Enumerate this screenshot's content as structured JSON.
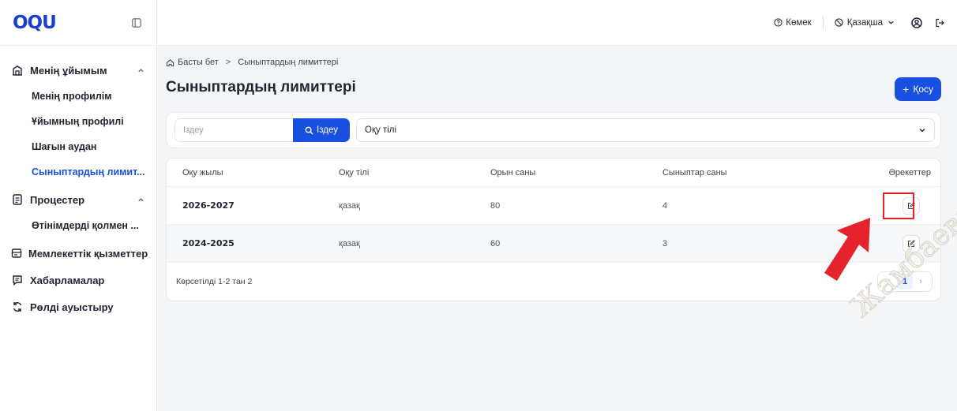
{
  "app": {
    "logo_text": "OQU"
  },
  "header": {
    "help_label": "Көмек",
    "language_label": "Қазақша",
    "user_icon": "user-circle-icon",
    "logout_icon": "logout-icon"
  },
  "sidebar": {
    "groups": [
      {
        "label": "Менің ұйымым",
        "icon": "building-icon",
        "expanded": true,
        "items": [
          {
            "label": "Менің профилім"
          },
          {
            "label": "Ұйымның профилі"
          },
          {
            "label": "Шағын аудан"
          },
          {
            "label": "Сыныптардың лимит...",
            "active": true
          }
        ]
      },
      {
        "label": "Процестер",
        "icon": "document-icon",
        "expanded": true,
        "items": [
          {
            "label": "Өтінімдерді қолмен ..."
          }
        ]
      },
      {
        "label": "Мемлекеттік қызметтер",
        "icon": "services-icon"
      },
      {
        "label": "Хабарламалар",
        "icon": "message-icon"
      },
      {
        "label": "Рөлді ауыстыру",
        "icon": "switch-icon"
      }
    ]
  },
  "main": {
    "breadcrumb": {
      "home": "Басты бет",
      "current": "Сыныптардың лимиттері"
    },
    "title": "Сыныптардың лимиттері",
    "add_button": "Қосу",
    "search": {
      "placeholder": "Іздеу",
      "button": "Іздеу"
    },
    "language_filter": {
      "placeholder": "Оқу тілі"
    },
    "table": {
      "columns": [
        "Оқу жылы",
        "Оқу тілі",
        "Орын саны",
        "Сыныптар саны",
        "Әрекеттер"
      ],
      "rows": [
        {
          "year": "2026-2027",
          "lang": "қазақ",
          "seats": "80",
          "classes": "4"
        },
        {
          "year": "2024-2025",
          "lang": "қазақ",
          "seats": "60",
          "classes": "3"
        }
      ],
      "footer": "Көрсетілді 1-2 тан 2",
      "page": "1"
    }
  },
  "overlay": {
    "watermark": "Жамбаева С.М",
    "highlight_color": "#e5232c"
  },
  "colors": {
    "accent": "#1a50e0",
    "highlight": "#e5232c"
  }
}
